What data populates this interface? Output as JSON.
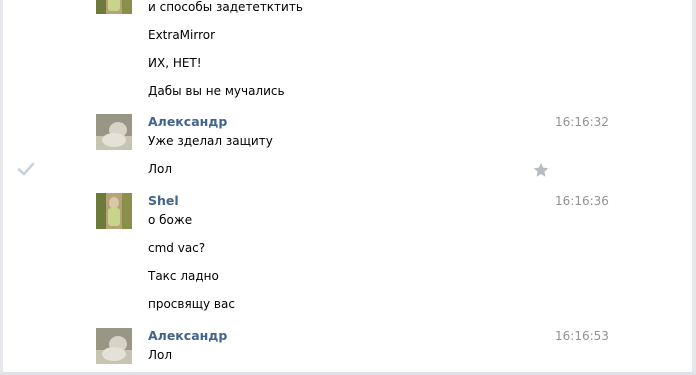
{
  "messages": {
    "m0": {
      "lines": [
        "и способы задететктить",
        "ExtraMirror",
        "ИХ, НЕТ!",
        "Дабы вы не мучались"
      ]
    },
    "m1": {
      "author": "Александр",
      "time": "16:16:32",
      "lines": [
        "Уже зделал защиту",
        "Лол"
      ]
    },
    "m2": {
      "author": "Shel",
      "time": "16:16:36",
      "lines": [
        "о боже",
        "cmd vac?",
        "Такс ладно",
        "просвящу вас"
      ]
    },
    "m3": {
      "author": "Александр",
      "time": "16:16:53",
      "lines": [
        "Лол"
      ]
    }
  },
  "colors": {
    "author": "#42648b",
    "time": "#939393",
    "check": "#c5d2e0",
    "star": "#b8bcc2"
  },
  "icons": {
    "checkmark": "check-icon",
    "favorite": "star-icon"
  }
}
